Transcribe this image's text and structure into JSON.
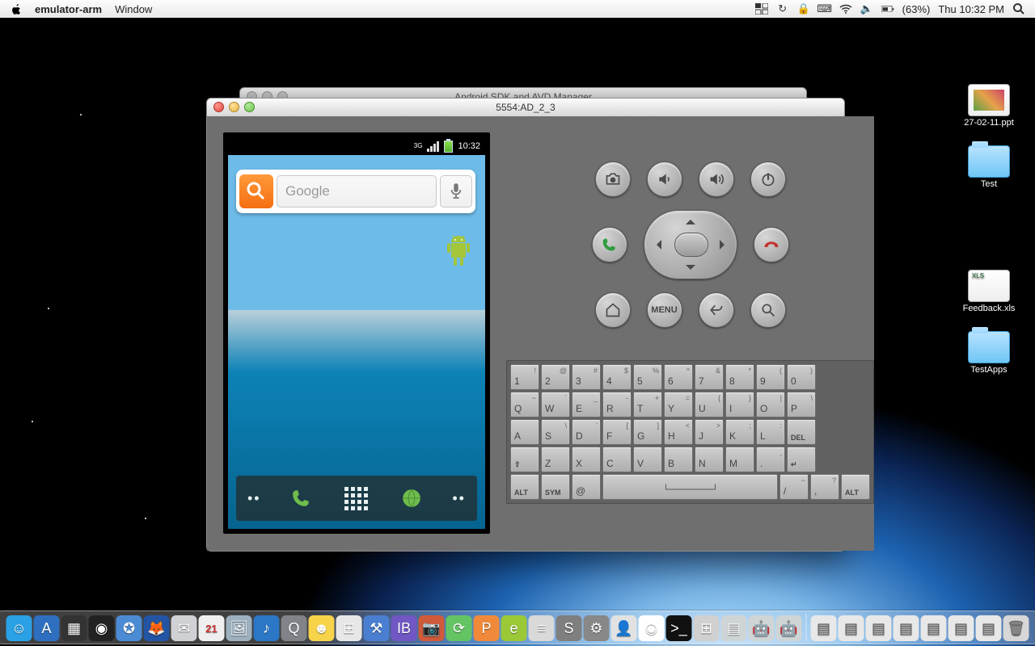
{
  "menubar": {
    "app": "emulator-arm",
    "menus": [
      "Window"
    ],
    "battery": "(63%)",
    "clock": "Thu 10:32 PM"
  },
  "desktop_icons": [
    {
      "name": "27-02-11.ppt",
      "kind": "ppt"
    },
    {
      "name": "Test",
      "kind": "folder"
    },
    {
      "name": "Feedback.xls",
      "kind": "xls"
    },
    {
      "name": "TestApps",
      "kind": "folder"
    }
  ],
  "avd_window": {
    "title": "Android SDK and AVD Manager"
  },
  "emulator": {
    "title": "5554:AD_2_3",
    "status_time": "10:32",
    "network_label": "3G",
    "search_placeholder": "Google",
    "controls": {
      "row1": [
        "camera",
        "vol-down",
        "vol-up",
        "power"
      ],
      "row2": [
        "call",
        "dpad",
        "end-call"
      ],
      "row3": [
        "home",
        "menu",
        "back",
        "search"
      ],
      "menu_label": "MENU"
    },
    "keyboard": [
      [
        {
          "m": "1",
          "s": "!"
        },
        {
          "m": "2",
          "s": "@"
        },
        {
          "m": "3",
          "s": "#"
        },
        {
          "m": "4",
          "s": "$"
        },
        {
          "m": "5",
          "s": "%"
        },
        {
          "m": "6",
          "s": "^"
        },
        {
          "m": "7",
          "s": "&"
        },
        {
          "m": "8",
          "s": "*"
        },
        {
          "m": "9",
          "s": "("
        },
        {
          "m": "0",
          "s": ")"
        }
      ],
      [
        {
          "m": "Q",
          "s": "~"
        },
        {
          "m": "W",
          "s": "`"
        },
        {
          "m": "E",
          "s": "_"
        },
        {
          "m": "R",
          "s": "-"
        },
        {
          "m": "T",
          "s": "+"
        },
        {
          "m": "Y",
          "s": "="
        },
        {
          "m": "U",
          "s": "{"
        },
        {
          "m": "I",
          "s": "}"
        },
        {
          "m": "O",
          "s": "|"
        },
        {
          "m": "P",
          "s": "\\"
        }
      ],
      [
        {
          "m": "A",
          "s": ""
        },
        {
          "m": "S",
          "s": "\\"
        },
        {
          "m": "D",
          "s": "'"
        },
        {
          "m": "F",
          "s": "["
        },
        {
          "m": "G",
          "s": "]"
        },
        {
          "m": "H",
          "s": "<"
        },
        {
          "m": "J",
          "s": ">"
        },
        {
          "m": "K",
          "s": ";"
        },
        {
          "m": "L",
          "s": ":"
        },
        {
          "m": "DEL",
          "s": "",
          "special": true
        }
      ],
      [
        {
          "m": "⇧",
          "s": "",
          "special": true
        },
        {
          "m": "Z",
          "s": ""
        },
        {
          "m": "X",
          "s": ""
        },
        {
          "m": "C",
          "s": ""
        },
        {
          "m": "V",
          "s": ""
        },
        {
          "m": "B",
          "s": ""
        },
        {
          "m": "N",
          "s": ""
        },
        {
          "m": "M",
          "s": ""
        },
        {
          "m": ".",
          "s": ","
        },
        {
          "m": "↵",
          "s": "",
          "special": true
        }
      ],
      [
        {
          "m": "ALT",
          "s": "",
          "special": true
        },
        {
          "m": "SYM",
          "s": "",
          "special": true
        },
        {
          "m": "@",
          "s": ""
        },
        {
          "m": "",
          "s": "",
          "space": true
        },
        {
          "m": "/",
          "s": "−"
        },
        {
          "m": ",",
          "s": "?"
        },
        {
          "m": "ALT",
          "s": "",
          "special": true
        }
      ]
    ]
  },
  "dock": [
    {
      "name": "finder",
      "bg": "#2aa0e5",
      "glyph": "☺"
    },
    {
      "name": "appstore",
      "bg": "#2f6fbf",
      "glyph": "A"
    },
    {
      "name": "expose",
      "bg": "#333",
      "glyph": "▦"
    },
    {
      "name": "dashboard",
      "bg": "#222",
      "glyph": "◉"
    },
    {
      "name": "safari",
      "bg": "#4b8bd4",
      "glyph": "✪"
    },
    {
      "name": "firefox",
      "bg": "#2355a4",
      "glyph": "🦊"
    },
    {
      "name": "mail",
      "bg": "#cfd1d4",
      "glyph": "✉"
    },
    {
      "name": "ical",
      "bg": "#efefef",
      "glyph": "21"
    },
    {
      "name": "preview",
      "bg": "#9db0bf",
      "glyph": "🖼"
    },
    {
      "name": "itunes",
      "bg": "#2b77c5",
      "glyph": "♪"
    },
    {
      "name": "quicktime",
      "bg": "#808488",
      "glyph": "Q"
    },
    {
      "name": "ym",
      "bg": "#f7d34a",
      "glyph": "☻"
    },
    {
      "name": "openoffice",
      "bg": "#e7e7e7",
      "glyph": "⊞"
    },
    {
      "name": "xcode",
      "bg": "#4a7ed0",
      "glyph": "⚒"
    },
    {
      "name": "ib",
      "bg": "#7057c4",
      "glyph": "IB"
    },
    {
      "name": "photobooth",
      "bg": "#d15a3a",
      "glyph": "📷"
    },
    {
      "name": "sync",
      "bg": "#64c464",
      "glyph": "⟳"
    },
    {
      "name": "p",
      "bg": "#f08a3a",
      "glyph": "P"
    },
    {
      "name": "e",
      "bg": "#9ac837",
      "glyph": "e"
    },
    {
      "name": "cisco",
      "bg": "#d9d9d9",
      "glyph": "≡"
    },
    {
      "name": "s",
      "bg": "#7f7f7f",
      "glyph": "S"
    },
    {
      "name": "sysprefs",
      "bg": "#888",
      "glyph": "⚙"
    },
    {
      "name": "msn",
      "bg": "#e2e2e2",
      "glyph": "👤"
    },
    {
      "name": "chrome",
      "bg": "#fff",
      "glyph": "◉"
    },
    {
      "name": "terminal",
      "bg": "#111",
      "glyph": ">_"
    },
    {
      "name": "calculator",
      "bg": "#d0d0d0",
      "glyph": "⊞"
    },
    {
      "name": "android-sdk",
      "bg": "#cfd4d6",
      "glyph": "▤"
    },
    {
      "name": "android",
      "bg": "#cfd4d6",
      "glyph": "🤖"
    },
    {
      "name": "android2",
      "bg": "#cfd4d6",
      "glyph": "🤖"
    }
  ],
  "dock_right": [
    {
      "name": "stack1",
      "bg": "#e8e8e8",
      "glyph": "▤"
    },
    {
      "name": "stack2",
      "bg": "#e8e8e8",
      "glyph": "▤"
    },
    {
      "name": "stack3",
      "bg": "#e8e8e8",
      "glyph": "▤"
    },
    {
      "name": "stack4",
      "bg": "#e8e8e8",
      "glyph": "▤"
    },
    {
      "name": "stack5",
      "bg": "#e8e8e8",
      "glyph": "▤"
    },
    {
      "name": "stack6",
      "bg": "#e8e8e8",
      "glyph": "▤"
    },
    {
      "name": "stack7",
      "bg": "#e8e8e8",
      "glyph": "▤"
    },
    {
      "name": "trash",
      "bg": "#d7d7d7",
      "glyph": "🗑"
    }
  ]
}
